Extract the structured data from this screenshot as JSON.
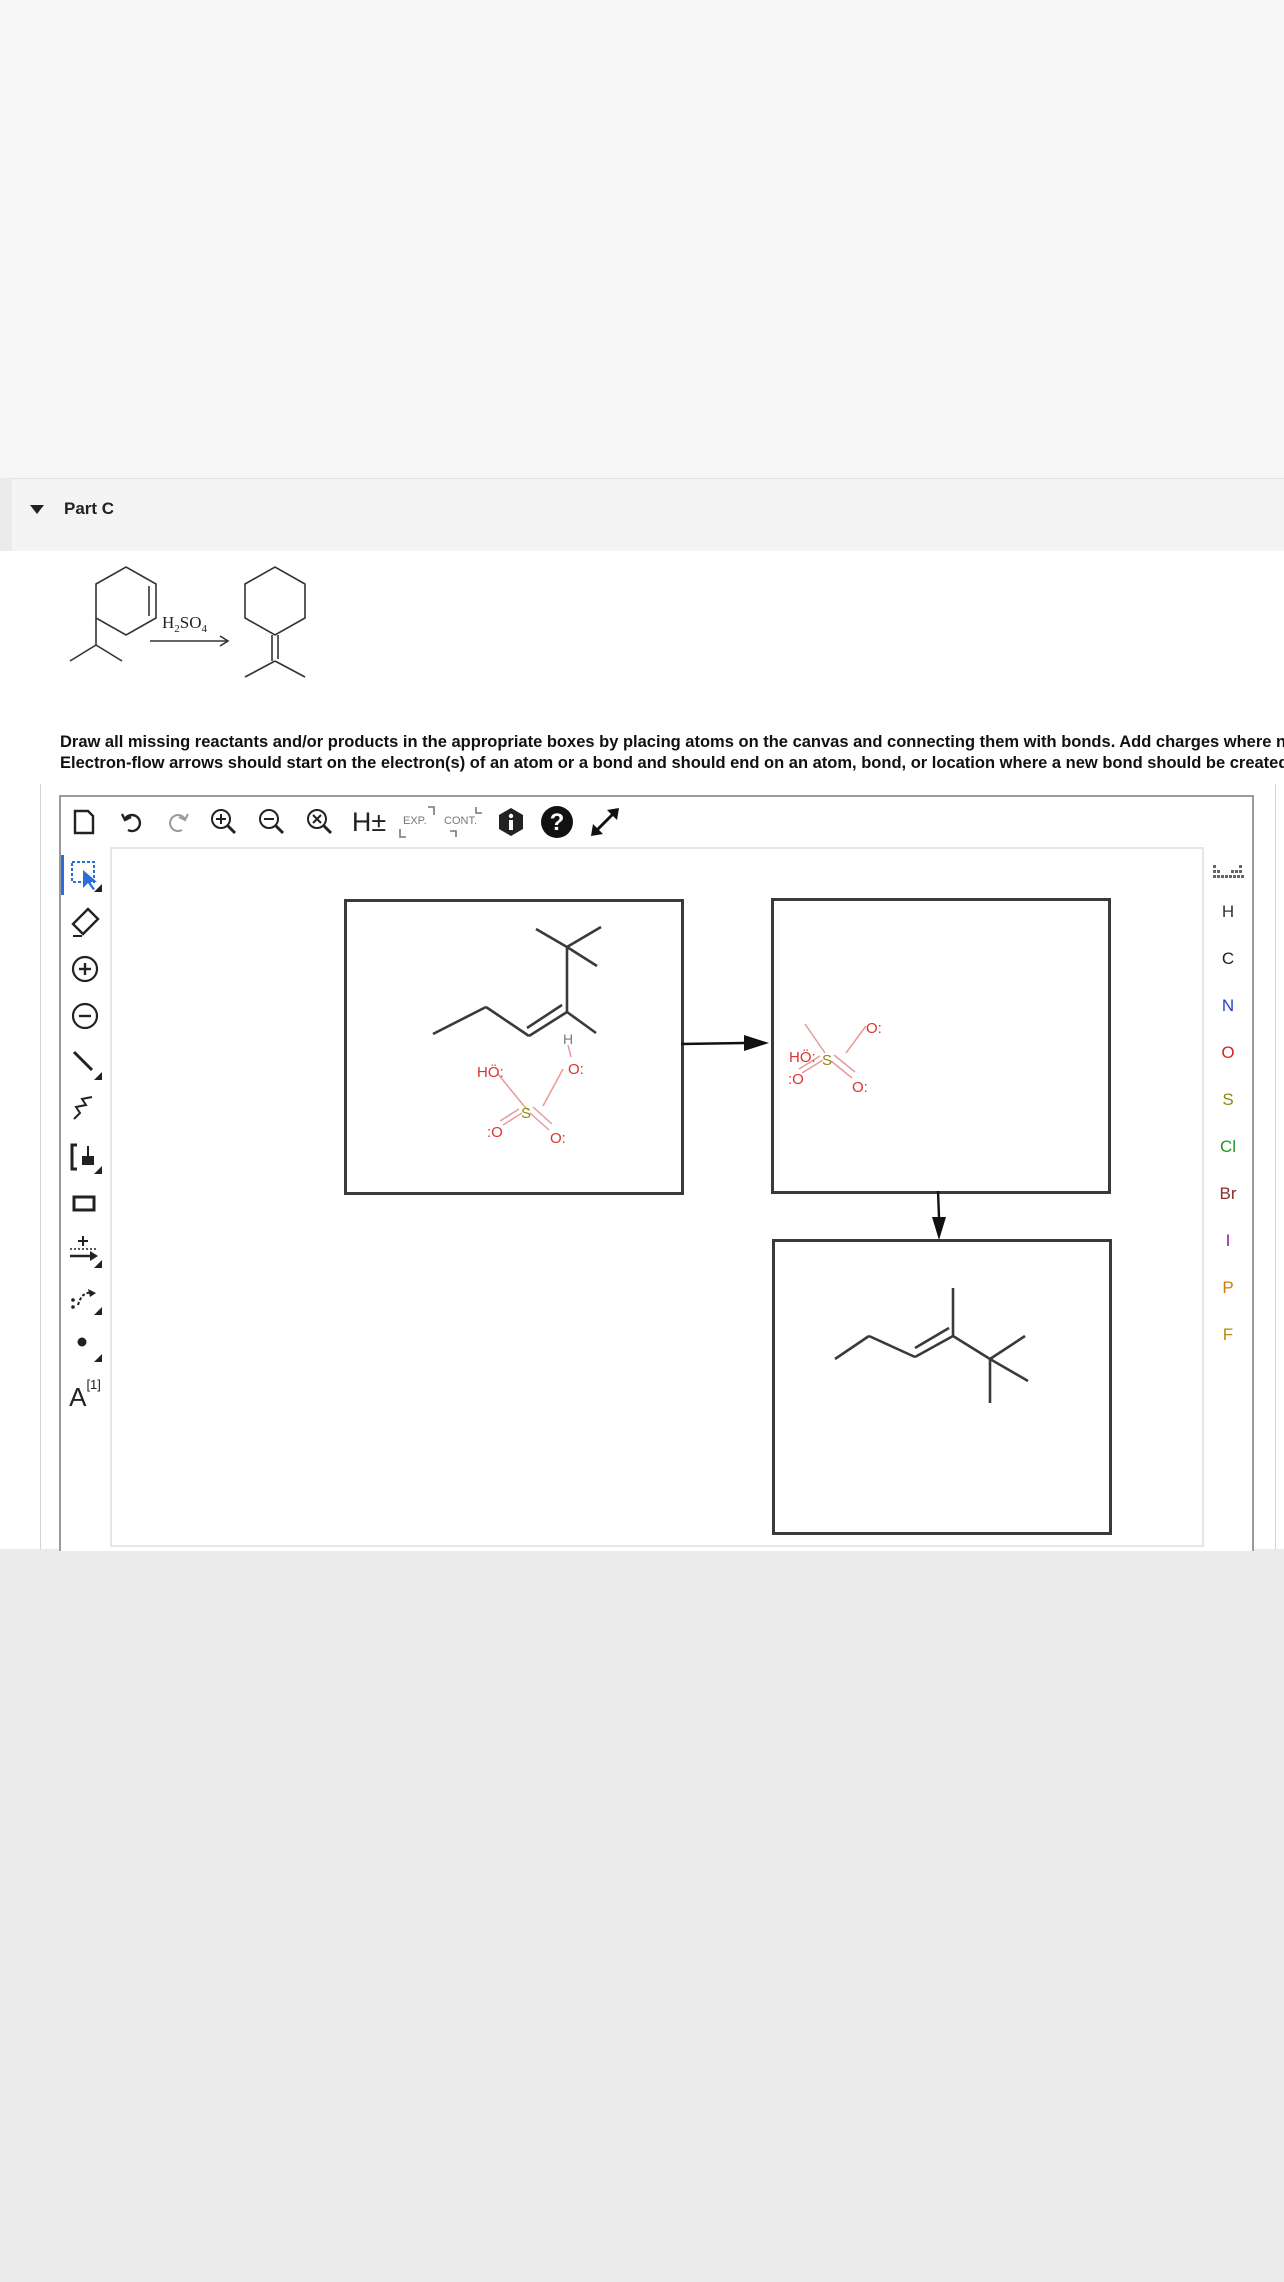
{
  "section": {
    "title": "Part C"
  },
  "reaction": {
    "reagent": "H2SO4"
  },
  "instructions": {
    "line1": "Draw all missing reactants and/or products in the appropriate boxes by placing atoms on the canvas and connecting them with bonds. Add charges where needed.",
    "line2": "Electron-flow arrows should start on the electron(s) of an atom or a bond and should end on an atom, bond, or location where a new bond should be created."
  },
  "toolbar": {
    "explicit_h_label": "H±",
    "exp_label": "EXP.",
    "cont_label": "CONT."
  },
  "tools": {
    "atom_label_tool": "A",
    "atom_label_index": "[1]"
  },
  "atoms": [
    "H",
    "C",
    "N",
    "O",
    "S",
    "Cl",
    "Br",
    "I",
    "P",
    "F"
  ],
  "atom_colors": {
    "H": "#333333",
    "C": "#222222",
    "N": "#2a3cd6",
    "O": "#e02020",
    "S": "#8a8a10",
    "Cl": "#1e9a1e",
    "Br": "#8b2a2a",
    "I": "#8a1fa8",
    "P": "#d07a10",
    "F": "#b88a10"
  },
  "canvas_labels": {
    "box1_ho": "HÖ:",
    "box1_h": "H",
    "box1_s": "S",
    "box1_o_right": "O:",
    "box1_o_bottom_left": ":O",
    "box1_o_bottom_right": "O:",
    "box2_ho": "HÖ:",
    "box2_s": "S",
    "box2_o_right": "O:",
    "box2_o_bottom_left": ":O",
    "box2_o_bottom_right": "O:"
  }
}
